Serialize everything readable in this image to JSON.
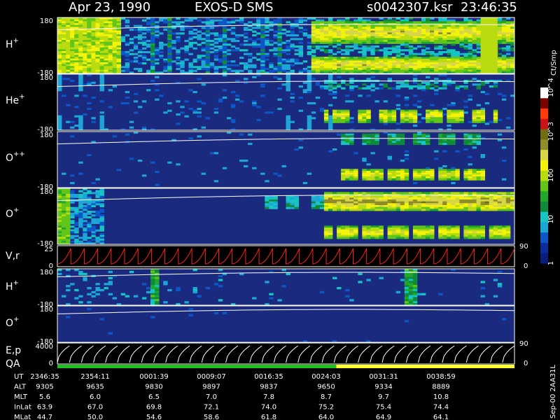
{
  "header": {
    "date": "Apr 23, 1990",
    "instrument": "EXOS-D SMS",
    "file": "s0042307.ksr",
    "time": "23:46:35"
  },
  "colorbar": {
    "unit_label": "Ct/Smp",
    "ticks": [
      {
        "label": "1",
        "v": 1
      },
      {
        "label": "10",
        "v": 10
      },
      {
        "label": "100",
        "v": 100
      },
      {
        "label": "10^3",
        "v": 1000
      },
      {
        "label": "10^4",
        "v": 10000
      }
    ],
    "colors": [
      "#0a1c7c",
      "#0d2c9c",
      "#0c56c8",
      "#1da5d8",
      "#17c4c4",
      "#0e8a3a",
      "#1fa82a",
      "#62c61a",
      "#b8dc10",
      "#f2f20a",
      "#d6d648",
      "#8e8e28",
      "#6e6e10",
      "#c81414",
      "#ff3a0a",
      "#7a0000",
      "#ffffff"
    ]
  },
  "side_label": "Sep-00 2AA31L",
  "chart_data": [
    {
      "type": "heatmap",
      "panel": "H+",
      "label": "H",
      "sup": "+",
      "yticks": [
        "180",
        "-180"
      ],
      "ylim": [
        -180,
        180
      ],
      "intensity_scale": "log",
      "cmin": 1,
      "cmax": 10000,
      "columns_in_time": "UT 2346:35 to ~0045:00",
      "bright_regions": [
        "flat green band across full pitch range 2346:35–2352",
        "bright arcs near +90 and -90 from 0022:00 onward"
      ]
    },
    {
      "type": "heatmap",
      "panel": "He+",
      "label": "He",
      "sup": "+",
      "yticks": [
        "180",
        "-180"
      ],
      "ylim": [
        -180,
        180
      ],
      "intensity_scale": "log",
      "cmin": 1,
      "cmax": 10000
    },
    {
      "type": "heatmap",
      "panel": "O++",
      "label": "O",
      "sup": "++",
      "yticks": [
        "180",
        "-180"
      ],
      "ylim": [
        -180,
        180
      ],
      "intensity_scale": "log",
      "cmin": 1,
      "cmax": 10000
    },
    {
      "type": "heatmap",
      "panel": "O+",
      "label": "O",
      "sup": "+",
      "yticks": [
        "180",
        "-180"
      ],
      "ylim": [
        -180,
        180
      ],
      "intensity_scale": "log",
      "cmin": 1,
      "cmax": 10000
    },
    {
      "type": "line",
      "panel": "V,r",
      "label": "V,r",
      "yticks": [
        "25",
        "0"
      ],
      "ylim": [
        0,
        25
      ],
      "right_ticks": [
        "90",
        "0"
      ],
      "series": [
        {
          "color": "#ff2020"
        }
      ]
    },
    {
      "type": "heatmap",
      "panel": "H+ (low energy)",
      "label": "H",
      "sup": "+",
      "yticks": [
        "180",
        "-180"
      ],
      "ylim": [
        -180,
        180
      ],
      "intensity_scale": "log"
    },
    {
      "type": "heatmap",
      "panel": "O+ (low energy)",
      "label": "O",
      "sup": "+",
      "yticks": [
        "180",
        "-180"
      ],
      "ylim": [
        -180,
        180
      ],
      "intensity_scale": "log"
    },
    {
      "type": "line",
      "panel": "E,p",
      "label": "E,p",
      "yticks": [
        "4000",
        "0"
      ],
      "ylim": [
        0,
        4000
      ],
      "right_ticks": [
        "90",
        "0"
      ],
      "series": [
        {
          "color": "#ffffff"
        }
      ]
    },
    {
      "type": "bar",
      "panel": "QA",
      "label": "QA",
      "segments": [
        {
          "from": 0,
          "to": 0.085,
          "quality": "#20c020"
        },
        {
          "from": 0.085,
          "to": 0.61,
          "quality": "#20c020"
        },
        {
          "from": 0.61,
          "to": 1.0,
          "quality": "#ffff30"
        }
      ]
    }
  ],
  "ephemeris": {
    "rows": [
      {
        "name": "UT",
        "values": [
          "2346:35",
          "2354:11",
          "0001:39",
          "0009:07",
          "0016:35",
          "0024:03",
          "0031:31",
          "0038:59"
        ]
      },
      {
        "name": "ALT",
        "values": [
          "9305",
          "9635",
          "9830",
          "9897",
          "9837",
          "9650",
          "9334",
          "8889"
        ]
      },
      {
        "name": "MLT",
        "values": [
          "5.6",
          "6.0",
          "6.5",
          "7.0",
          "7.8",
          "8.7",
          "9.7",
          "10.8"
        ]
      },
      {
        "name": "InLat",
        "values": [
          "63.9",
          "67.0",
          "69.8",
          "72.1",
          "74.0",
          "75.2",
          "75.4",
          "74.4"
        ]
      },
      {
        "name": "MLat",
        "values": [
          "44.7",
          "50.0",
          "54.6",
          "58.6",
          "61.8",
          "64.0",
          "64.9",
          "64.1"
        ]
      }
    ]
  }
}
